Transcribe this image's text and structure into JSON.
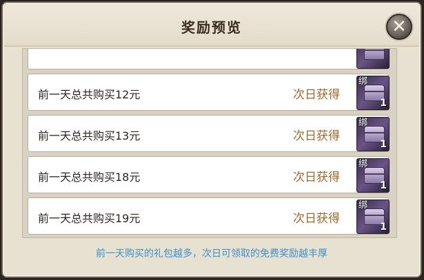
{
  "dialog": {
    "title": "奖励预览",
    "close_icon": "close-icon"
  },
  "rewards": [
    {
      "label": "",
      "status": "",
      "bind_tag": "",
      "quantity": ""
    },
    {
      "label": "前一天总共购买12元",
      "status": "次日获得",
      "bind_tag": "绑",
      "quantity": "1"
    },
    {
      "label": "前一天总共购买13元",
      "status": "次日获得",
      "bind_tag": "绑",
      "quantity": "1"
    },
    {
      "label": "前一天总共购买18元",
      "status": "次日获得",
      "bind_tag": "绑",
      "quantity": "1"
    },
    {
      "label": "前一天总共购买19元",
      "status": "次日获得",
      "bind_tag": "绑",
      "quantity": "1"
    }
  ],
  "footer_note": "前一天购买的礼包越多，次日可领取的免费奖励越丰厚"
}
